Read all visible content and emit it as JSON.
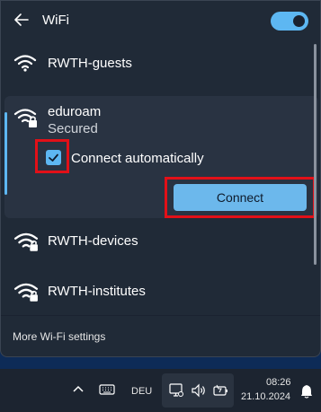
{
  "header": {
    "title": "WiFi",
    "wifi_enabled": true
  },
  "networks": [
    {
      "name": "RWTH-guests",
      "secured": false
    },
    {
      "name": "eduroam",
      "status": "Secured",
      "secured": true,
      "expanded": true,
      "connect_automatically_label": "Connect automatically",
      "connect_automatically": true,
      "connect_label": "Connect"
    },
    {
      "name": "RWTH-devices",
      "secured": true
    },
    {
      "name": "RWTH-institutes",
      "secured": true
    }
  ],
  "footer": {
    "more_settings_label": "More Wi-Fi settings"
  },
  "taskbar": {
    "language": "DEU",
    "time": "08:26",
    "date": "21.10.2024",
    "icons": [
      "chevron-up-icon",
      "keyboard-icon",
      "network-icon",
      "volume-icon",
      "battery-icon",
      "notification-bell-icon"
    ]
  },
  "colors": {
    "accent": "#5db7f2",
    "highlight": "#e21018",
    "panel": "#202a37"
  }
}
